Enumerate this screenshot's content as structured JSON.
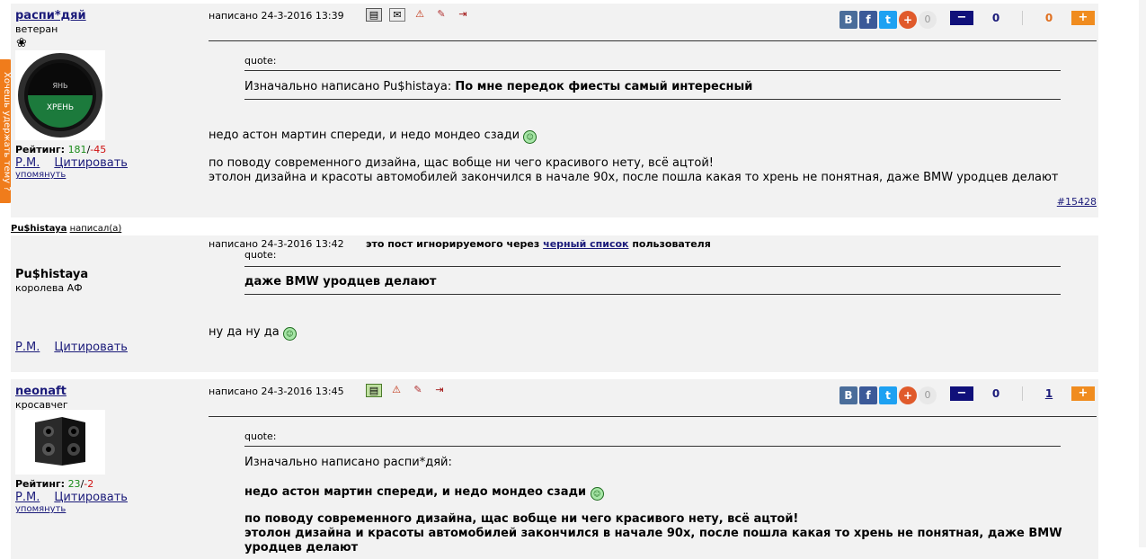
{
  "side_tab": "Хочешь удержать тему ?",
  "posts": [
    {
      "username": "распи*дяй",
      "rank": "ветеран",
      "rating_label": "Рейтинг:",
      "rating_pos": "181",
      "rating_neg": "-45",
      "pm": "Р.М.",
      "quote": "Цитировать",
      "mention": "упомянуть",
      "date": "написано 24-3-2016 13:39",
      "quote_label": "quote:",
      "quote_intro": "Изначально написано Pu$histaya:",
      "quote_bold": "По мне передок фиесты самый интересный",
      "line1": "недо астон мартин спереди, и недо мондео сзади",
      "line2": "по поводу современного дизайна, щас вобще ни чего красивого нету, всё ацтой!",
      "line3": "этолон дизайна и красоты автомобилей закончился в начале 90х, после пошла какая то хрень не понятная, даже BMW уродцев делают",
      "post_number": "#15428",
      "share_count": "0",
      "vote_left": "0",
      "vote_right": "0"
    },
    {
      "username": "Pu$histaya",
      "rank": "королева АФ",
      "pm": "Р.М.",
      "quote": "Цитировать",
      "date": "написано 24-3-2016 13:42",
      "ignored_prefix": "это пост игнорируемого через",
      "ignored_link": "черный список",
      "ignored_suffix": "пользователя",
      "quote_label": "quote:",
      "quote_bold": "даже BMW уродцев делают",
      "line1": "ну да ну да"
    },
    {
      "username": "neonaft",
      "rank": "кросавчег",
      "rating_label": "Рейтинг:",
      "rating_pos": "23",
      "rating_neg": "-2",
      "pm": "Р.М.",
      "quote": "Цитировать",
      "mention": "упомянуть",
      "date": "написано 24-3-2016 13:45",
      "quote_label": "quote:",
      "quote_intro": "Изначально написано распи*дяй:",
      "quote_b1": "недо астон мартин спереди, и недо мондео сзади",
      "quote_b2": "по поводу современного дизайна, щас вобще ни чего красивого нету, всё ацтой!",
      "quote_b3": "этолон дизайна и красоты автомобилей закончился в начале 90х, после пошла какая то хрень не понятная, даже BMW",
      "quote_b4": "уродцев делают",
      "share_count": "0",
      "vote_left": "0",
      "vote_right": "1"
    }
  ],
  "wrote_user": "Pu$histaya",
  "wrote_text": "написал(а)",
  "share": {
    "vk": "В",
    "fb": "f",
    "tw": "t",
    "plus": "+"
  },
  "vote": {
    "minus": "−",
    "plus": "+"
  },
  "avatar1_text": "ХРЕНЬ",
  "colors": {
    "accent_orange": "#f08c1f",
    "vote_blue": "#10107a",
    "post_bg": "#f2f2f2"
  }
}
